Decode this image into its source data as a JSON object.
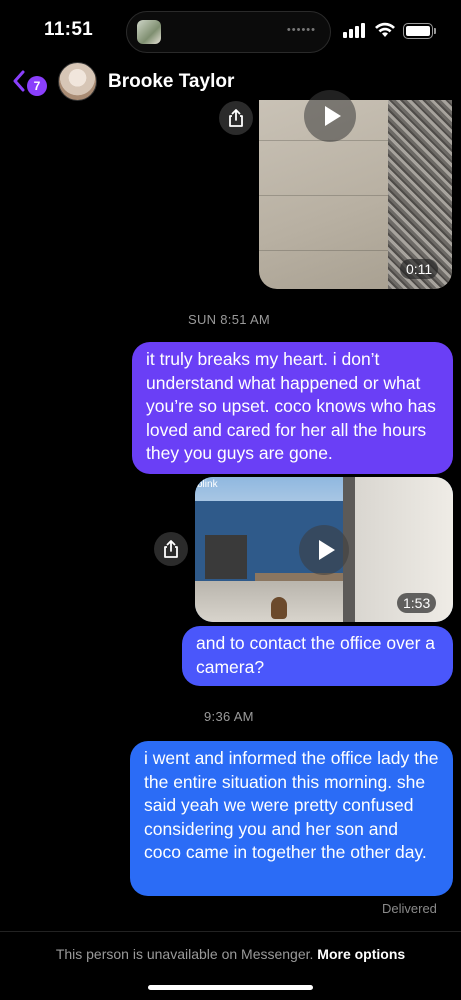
{
  "status_bar": {
    "time": "11:51",
    "icons": [
      "island-thumbnail-icon",
      "cellular-signal-icon",
      "wifi-icon",
      "battery-icon"
    ]
  },
  "header": {
    "back_badge_count": "7",
    "contact_name": "Brooke Taylor",
    "accent_color": "#8a3ffc"
  },
  "messages": [
    {
      "type": "video",
      "duration": "0:11"
    },
    {
      "type": "timestamp",
      "text": "SUN 8:51 AM"
    },
    {
      "type": "text",
      "text": "it truly breaks my heart. i don’t understand what happened or what you’re so upset. coco knows who has loved and cared for her all the hours they you guys are gone."
    },
    {
      "type": "video",
      "duration": "1:53",
      "overlay_text": "blink"
    },
    {
      "type": "text",
      "text": "and to contact the office over a camera?"
    },
    {
      "type": "timestamp",
      "text": "9:36 AM"
    },
    {
      "type": "text",
      "text": "i went and informed the office lady the the entire situation this morning. she said yeah we were pretty confused considering you and her son and coco came in together the other day."
    }
  ],
  "delivery_status": "Delivered",
  "footer": {
    "notice": "This person is unavailable on Messenger.",
    "action": "More options"
  },
  "colors": {
    "bubble_top": "#6a3ff6",
    "bubble_mid": "#4a57fb",
    "bubble_bottom": "#2b6cf6",
    "background": "#000000"
  }
}
